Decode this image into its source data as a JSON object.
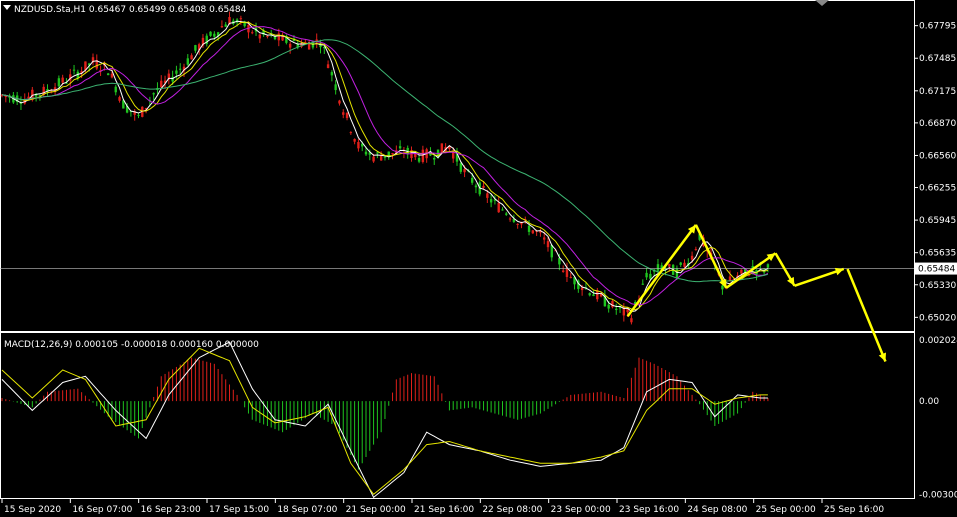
{
  "header": {
    "symbol_line": "NZDUSD.Sta,H1  0.65467 0.65499 0.65408 0.65484"
  },
  "macd_header": "MACD(12,26,9) 0.000105 -0.000018 0.000160 0.000000",
  "colors": {
    "background": "#000000",
    "grid": "#ffffff",
    "bull": "#e0201a",
    "bear": "#1fc51f",
    "ma_fast": "#ffffff",
    "ma_mid": "#e5e500",
    "ma_slow": "#c020e0",
    "ma_long": "#3cb371",
    "arrows": "#ffff00",
    "price_tag": "#ffffff"
  },
  "chart_data": [
    {
      "type": "candlestick",
      "symbol": "NZDUSD.Sta",
      "timeframe": "H1",
      "y_ticks": [
        "0.67795",
        "0.67485",
        "0.67175",
        "0.66870",
        "0.66560",
        "0.66255",
        "0.65945",
        "0.65635",
        "0.65330",
        "0.65020"
      ],
      "ylim": [
        0.6489,
        0.6802
      ],
      "current_price": "0.65484",
      "x_ticks": [
        "15 Sep 2020",
        "16 Sep 07:00",
        "16 Sep 23:00",
        "17 Sep 15:00",
        "18 Sep 07:00",
        "21 Sep 00:00",
        "21 Sep 16:00",
        "22 Sep 08:00",
        "23 Sep 00:00",
        "23 Sep 16:00",
        "24 Sep 08:00",
        "25 Sep 00:00",
        "25 Sep 16:00"
      ],
      "price_path": [
        [
          0,
          0.6713
        ],
        [
          6,
          0.671
        ],
        [
          12,
          0.6718
        ],
        [
          18,
          0.673
        ],
        [
          24,
          0.6745
        ],
        [
          28,
          0.6738
        ],
        [
          32,
          0.6705
        ],
        [
          36,
          0.6692
        ],
        [
          40,
          0.6715
        ],
        [
          44,
          0.6728
        ],
        [
          48,
          0.6742
        ],
        [
          52,
          0.676
        ],
        [
          56,
          0.6772
        ],
        [
          60,
          0.6785
        ],
        [
          64,
          0.678
        ],
        [
          68,
          0.677
        ],
        [
          72,
          0.6768
        ],
        [
          76,
          0.6764
        ],
        [
          80,
          0.6762
        ],
        [
          84,
          0.6765
        ],
        [
          86,
          0.6745
        ],
        [
          90,
          0.67
        ],
        [
          94,
          0.6665
        ],
        [
          98,
          0.6655
        ],
        [
          102,
          0.6657
        ],
        [
          106,
          0.666
        ],
        [
          110,
          0.6655
        ],
        [
          114,
          0.6658
        ],
        [
          118,
          0.6665
        ],
        [
          122,
          0.664
        ],
        [
          126,
          0.6625
        ],
        [
          130,
          0.661
        ],
        [
          134,
          0.66
        ],
        [
          138,
          0.659
        ],
        [
          142,
          0.658
        ],
        [
          146,
          0.656
        ],
        [
          150,
          0.654
        ],
        [
          154,
          0.653
        ],
        [
          158,
          0.652
        ],
        [
          162,
          0.651
        ],
        [
          166,
          0.6503
        ],
        [
          170,
          0.654
        ],
        [
          174,
          0.655
        ],
        [
          178,
          0.6545
        ],
        [
          182,
          0.656
        ],
        [
          184,
          0.658
        ],
        [
          188,
          0.655
        ],
        [
          190,
          0.6532
        ],
        [
          194,
          0.654
        ],
        [
          198,
          0.6548
        ],
        [
          202,
          0.6548
        ]
      ],
      "arrows": [
        {
          "from": [
            165,
            0.6503
          ],
          "to": [
            183,
            0.659
          ]
        },
        {
          "from": [
            183,
            0.659
          ],
          "to": [
            191,
            0.653
          ]
        },
        {
          "from": [
            191,
            0.653
          ],
          "to": [
            204,
            0.6563
          ]
        },
        {
          "from": [
            204,
            0.6563
          ],
          "to": [
            209,
            0.6532
          ]
        },
        {
          "from": [
            209,
            0.6532
          ],
          "to": [
            222,
            0.6548
          ]
        },
        {
          "from": [
            223,
            0.6548
          ],
          "to": [
            233,
            0.646
          ]
        }
      ]
    },
    {
      "type": "bar",
      "name": "MACD(12,26,9)",
      "y_ticks": [
        "0.002024",
        "0.00",
        "-0.003007"
      ],
      "ylim": [
        -0.00315,
        0.00216
      ],
      "histogram": [
        [
          0,
          0.0001
        ],
        [
          8,
          -0.0002
        ],
        [
          12,
          0.0003
        ],
        [
          20,
          0.0004
        ],
        [
          28,
          -0.0005
        ],
        [
          36,
          -0.0012
        ],
        [
          42,
          0.0008
        ],
        [
          50,
          0.0014
        ],
        [
          56,
          0.0012
        ],
        [
          62,
          0.0002
        ],
        [
          66,
          -0.0006
        ],
        [
          74,
          -0.001
        ],
        [
          82,
          -0.0004
        ],
        [
          88,
          -0.0008
        ],
        [
          94,
          -0.0022
        ],
        [
          100,
          -0.001
        ],
        [
          104,
          0.0007
        ],
        [
          108,
          0.0009
        ],
        [
          114,
          0.0008
        ],
        [
          118,
          -0.0003
        ],
        [
          124,
          -0.0002
        ],
        [
          130,
          -0.0004
        ],
        [
          136,
          -0.0006
        ],
        [
          142,
          -0.0004
        ],
        [
          150,
          0.0002
        ],
        [
          158,
          0.0003
        ],
        [
          164,
          0.0001
        ],
        [
          168,
          0.0014
        ],
        [
          172,
          0.0012
        ],
        [
          178,
          0.0008
        ],
        [
          184,
          -0.0001
        ],
        [
          188,
          -0.0008
        ],
        [
          194,
          -0.0004
        ],
        [
          198,
          0.0003
        ],
        [
          202,
          0.0001
        ]
      ],
      "signal": [
        [
          0,
          0.001
        ],
        [
          8,
          0.0001
        ],
        [
          16,
          0.001
        ],
        [
          22,
          0.0007
        ],
        [
          30,
          -0.0008
        ],
        [
          38,
          -0.0006
        ],
        [
          44,
          0.0007
        ],
        [
          52,
          0.0017
        ],
        [
          60,
          0.0013
        ],
        [
          66,
          -0.0002
        ],
        [
          72,
          -0.0007
        ],
        [
          80,
          -0.0005
        ],
        [
          86,
          -0.0002
        ],
        [
          92,
          -0.002
        ],
        [
          98,
          -0.003
        ],
        [
          106,
          -0.0022
        ],
        [
          112,
          -0.0014
        ],
        [
          118,
          -0.0013
        ],
        [
          126,
          -0.0016
        ],
        [
          134,
          -0.0018
        ],
        [
          142,
          -0.002
        ],
        [
          150,
          -0.002
        ],
        [
          158,
          -0.0018
        ],
        [
          164,
          -0.0016
        ],
        [
          170,
          -0.0003
        ],
        [
          176,
          0.0004
        ],
        [
          182,
          0.0004
        ],
        [
          188,
          -0.0001
        ],
        [
          194,
          0.0001
        ],
        [
          200,
          0.0002
        ]
      ],
      "macd": [
        [
          0,
          0.0007
        ],
        [
          8,
          -0.0003
        ],
        [
          16,
          0.0006
        ],
        [
          22,
          0.0008
        ],
        [
          30,
          -0.0003
        ],
        [
          38,
          -0.0012
        ],
        [
          44,
          0.0002
        ],
        [
          52,
          0.0014
        ],
        [
          60,
          0.0019
        ],
        [
          66,
          0.0004
        ],
        [
          72,
          -0.0006
        ],
        [
          80,
          -0.0008
        ],
        [
          86,
          -0.0001
        ],
        [
          92,
          -0.0016
        ],
        [
          98,
          -0.0031
        ],
        [
          106,
          -0.0023
        ],
        [
          112,
          -0.001
        ],
        [
          118,
          -0.0014
        ],
        [
          126,
          -0.0016
        ],
        [
          134,
          -0.0019
        ],
        [
          142,
          -0.0021
        ],
        [
          150,
          -0.002
        ],
        [
          158,
          -0.0019
        ],
        [
          164,
          -0.0015
        ],
        [
          170,
          0.0003
        ],
        [
          176,
          0.0007
        ],
        [
          182,
          0.0006
        ],
        [
          188,
          -0.0005
        ],
        [
          194,
          0.0002
        ],
        [
          200,
          0.0001
        ]
      ]
    }
  ]
}
